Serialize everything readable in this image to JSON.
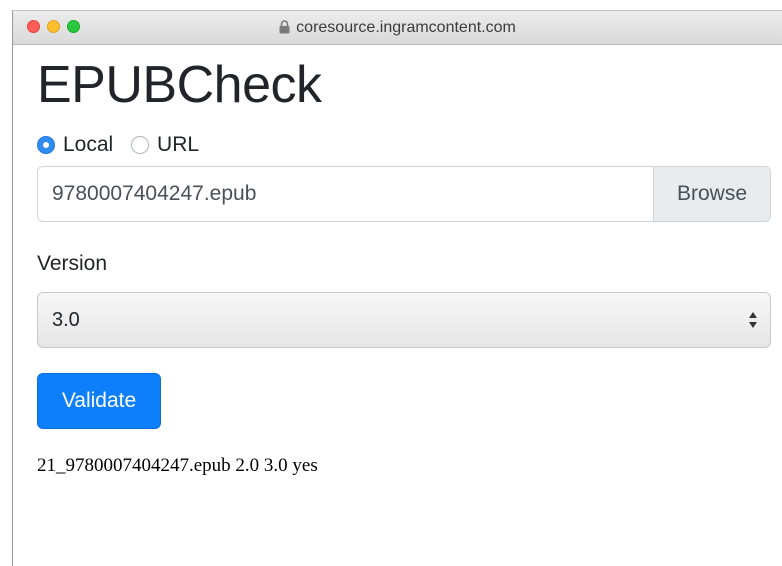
{
  "browser": {
    "address": "coresource.ingramcontent.com",
    "lock_icon": "lock-icon"
  },
  "page": {
    "title": "EPUBCheck"
  },
  "source": {
    "options": [
      {
        "label": "Local",
        "checked": true
      },
      {
        "label": "URL",
        "checked": false
      }
    ]
  },
  "file": {
    "value": "9780007404247.epub",
    "browse_label": "Browse"
  },
  "version": {
    "label": "Version",
    "selected": "3.0"
  },
  "actions": {
    "validate_label": "Validate"
  },
  "result": {
    "text": "21_9780007404247.epub 2.0 3.0 yes"
  },
  "colors": {
    "primary": "#0d7ffb",
    "radio_checked": "#2f8cf0",
    "traffic_red": "#ff5f57",
    "traffic_yellow": "#ffbd2e",
    "traffic_green": "#28c840"
  }
}
